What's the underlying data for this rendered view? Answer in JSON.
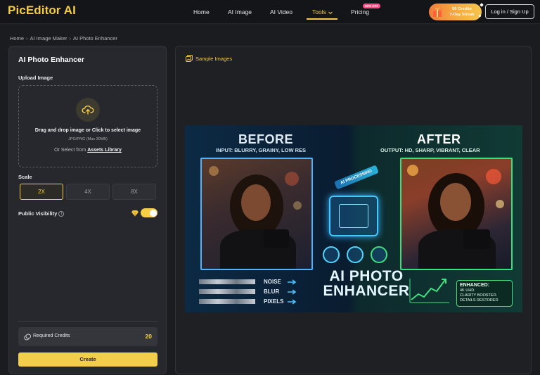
{
  "header": {
    "logo": "PicEditor AI",
    "nav": [
      {
        "label": "Home"
      },
      {
        "label": "AI Image"
      },
      {
        "label": "AI Video"
      },
      {
        "label": "Tools"
      },
      {
        "label": "Pricing"
      }
    ],
    "pricing_badge": "90% OFF",
    "credits_pill_line1": "50 Credits",
    "credits_pill_line2": "7-Day Streak",
    "login_label": "Log in / Sign Up",
    "accent_color": "#f6cd45"
  },
  "breadcrumb": {
    "items": [
      "Home",
      "AI Image Maker",
      "AI Photo Enhancer"
    ],
    "separator": "›"
  },
  "left_panel": {
    "title": "AI Photo Enhancer",
    "upload_label": "Upload Image",
    "dropzone_main": "Drag and drop image or Click to select image",
    "dropzone_sub": "JPG/PNG (Max 30MB)",
    "dropzone_lib_prefix": "Or Select from",
    "dropzone_lib_link": "Assets Library",
    "scale_label": "Scale",
    "scale_options": [
      "2X",
      "4X",
      "8X"
    ],
    "scale_selected": "2X",
    "visibility_label": "Public Visibility",
    "visibility_on": true,
    "credits_label": "Required Credits",
    "credits_value": "20",
    "create_label": "Create"
  },
  "right_panel": {
    "sample_label": "Sample Images",
    "preview": {
      "before_title": "BEFORE",
      "before_sub": "INPUT: BLURRY, GRAINY, LOW RES",
      "after_title": "AFTER",
      "after_sub": "OUTPUT: HD, SHARP, VIBRANT, CLEAR",
      "processing": "AI PROCESSING",
      "title_line1": "AI PHOTO",
      "title_line2": "ENHANCER",
      "bars": [
        "NOISE",
        "BLUR",
        "PIXELS"
      ],
      "enhanced_title": "ENHANCED:",
      "enhanced_l1": "4K UHD.",
      "enhanced_l2": "CLARITY BOOSTED.",
      "enhanced_l3": "DETAILS RESTORED"
    }
  }
}
